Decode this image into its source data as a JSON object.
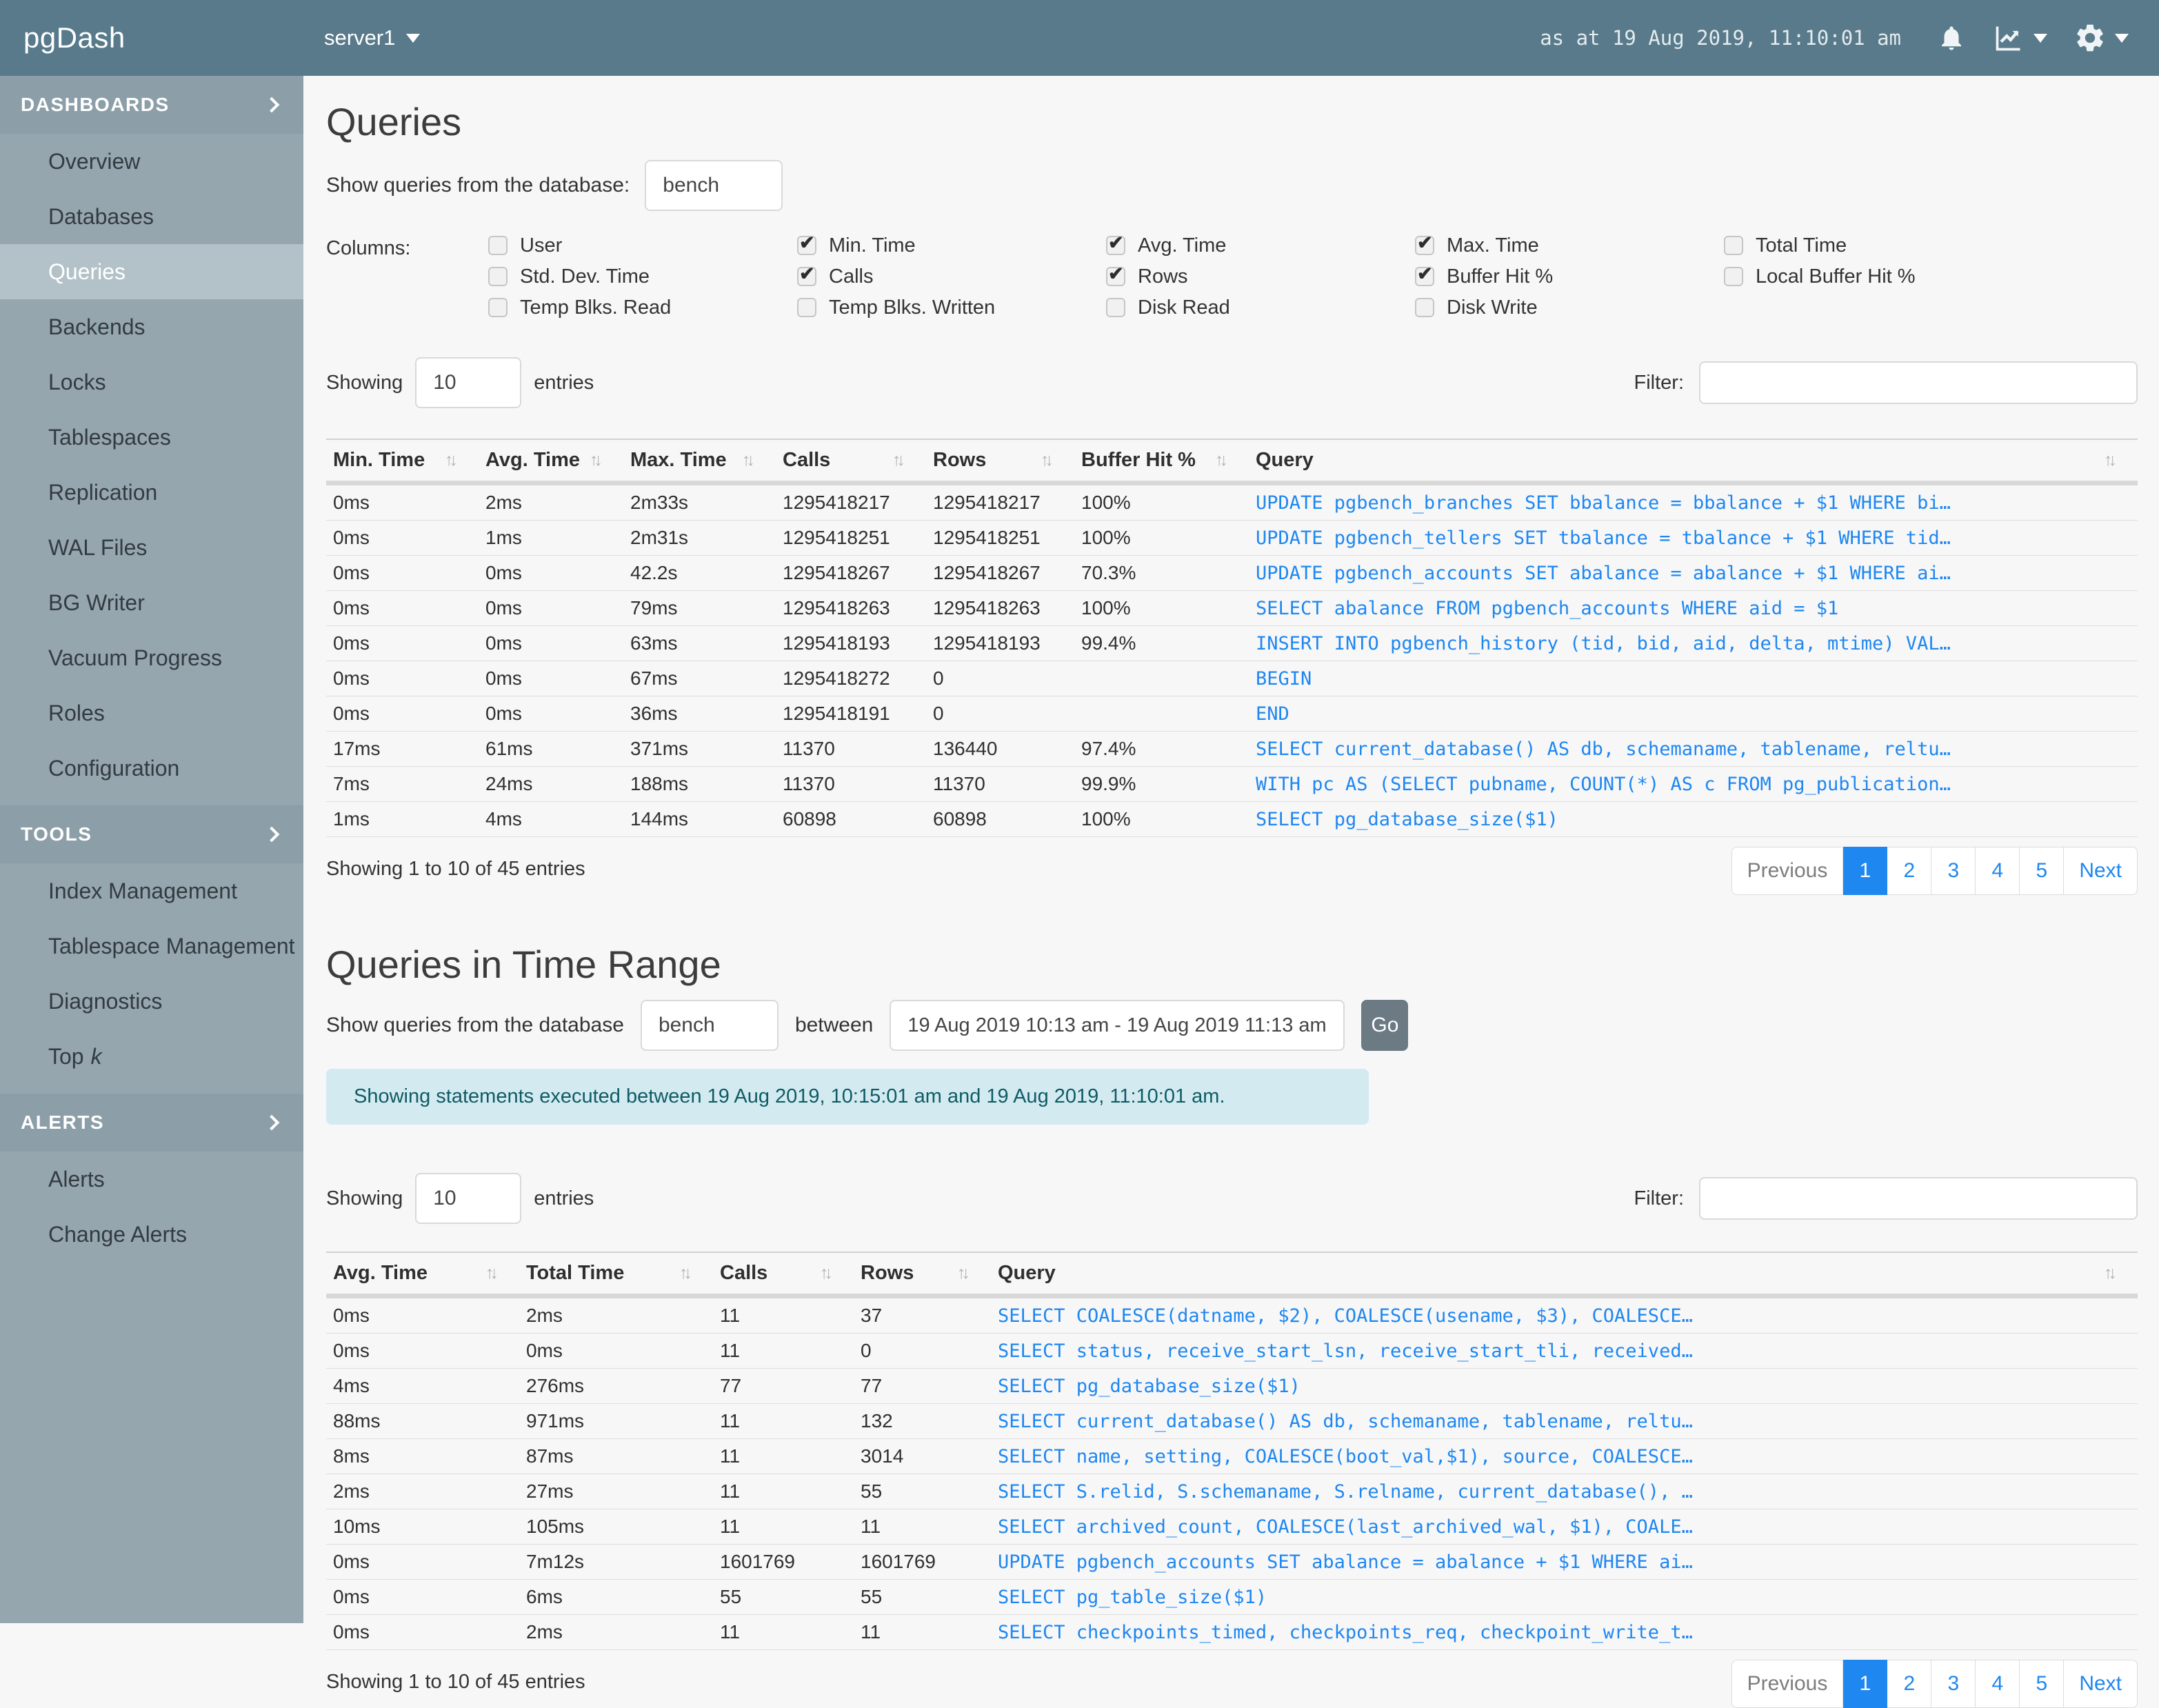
{
  "topbar": {
    "brand": "pgDash",
    "server": "server1",
    "timestamp": "as at 19 Aug 2019, 11:10:01 am"
  },
  "sidebar": {
    "sections": [
      {
        "label": "DASHBOARDS",
        "items": [
          {
            "label": "Overview"
          },
          {
            "label": "Databases"
          },
          {
            "label": "Queries",
            "active": true
          },
          {
            "label": "Backends"
          },
          {
            "label": "Locks"
          },
          {
            "label": "Tablespaces"
          },
          {
            "label": "Replication"
          },
          {
            "label": "WAL Files"
          },
          {
            "label": "BG Writer"
          },
          {
            "label": "Vacuum Progress"
          },
          {
            "label": "Roles"
          },
          {
            "label": "Configuration"
          }
        ]
      },
      {
        "label": "TOOLS",
        "items": [
          {
            "label": "Index Management"
          },
          {
            "label": "Tablespace Management"
          },
          {
            "label": "Diagnostics"
          },
          {
            "label": "Top",
            "italic": "k"
          }
        ]
      },
      {
        "label": "ALERTS",
        "items": [
          {
            "label": "Alerts"
          },
          {
            "label": "Change Alerts"
          }
        ]
      }
    ]
  },
  "q1": {
    "title": "Queries",
    "db_label": "Show queries from the database:",
    "db_value": "bench",
    "columns_label": "Columns:",
    "checkbox_columns": [
      [
        {
          "label": "User",
          "checked": false
        },
        {
          "label": "Std. Dev. Time",
          "checked": false
        },
        {
          "label": "Temp Blks. Read",
          "checked": false
        }
      ],
      [
        {
          "label": "Min. Time",
          "checked": true
        },
        {
          "label": "Calls",
          "checked": true
        },
        {
          "label": "Temp Blks. Written",
          "checked": false
        }
      ],
      [
        {
          "label": "Avg. Time",
          "checked": true
        },
        {
          "label": "Rows",
          "checked": true
        },
        {
          "label": "Disk Read",
          "checked": false
        }
      ],
      [
        {
          "label": "Max. Time",
          "checked": true
        },
        {
          "label": "Buffer Hit %",
          "checked": true
        },
        {
          "label": "Disk Write",
          "checked": false
        }
      ],
      [
        {
          "label": "Total Time",
          "checked": false
        },
        {
          "label": "Local Buffer Hit %",
          "checked": false
        }
      ]
    ],
    "showing_label": "Showing",
    "entries_value": "10",
    "entries_label": "entries",
    "filter_label": "Filter:",
    "filter_value": "",
    "table": {
      "headers": [
        "Min. Time",
        "Avg. Time",
        "Max. Time",
        "Calls",
        "Rows",
        "Buffer Hit %",
        "Query"
      ],
      "rows": [
        [
          "0ms",
          "2ms",
          "2m33s",
          "1295418217",
          "1295418217",
          "100%",
          "UPDATE pgbench_branches SET bbalance = bbalance + $1 WHERE bi…"
        ],
        [
          "0ms",
          "1ms",
          "2m31s",
          "1295418251",
          "1295418251",
          "100%",
          "UPDATE pgbench_tellers SET tbalance = tbalance + $1 WHERE tid…"
        ],
        [
          "0ms",
          "0ms",
          "42.2s",
          "1295418267",
          "1295418267",
          "70.3%",
          "UPDATE pgbench_accounts SET abalance = abalance + $1 WHERE ai…"
        ],
        [
          "0ms",
          "0ms",
          "79ms",
          "1295418263",
          "1295418263",
          "100%",
          "SELECT abalance FROM pgbench_accounts WHERE aid = $1"
        ],
        [
          "0ms",
          "0ms",
          "63ms",
          "1295418193",
          "1295418193",
          "99.4%",
          "INSERT INTO pgbench_history (tid, bid, aid, delta, mtime) VAL…"
        ],
        [
          "0ms",
          "0ms",
          "67ms",
          "1295418272",
          "0",
          "",
          "BEGIN"
        ],
        [
          "0ms",
          "0ms",
          "36ms",
          "1295418191",
          "0",
          "",
          "END"
        ],
        [
          "17ms",
          "61ms",
          "371ms",
          "11370",
          "136440",
          "97.4%",
          "SELECT current_database() AS db, schemaname, tablename, reltu…"
        ],
        [
          "7ms",
          "24ms",
          "188ms",
          "11370",
          "11370",
          "99.9%",
          "WITH pc AS (SELECT pubname, COUNT(*) AS c FROM pg_publication…"
        ],
        [
          "1ms",
          "4ms",
          "144ms",
          "60898",
          "60898",
          "100%",
          "SELECT pg_database_size($1)"
        ]
      ]
    },
    "summary": "Showing 1 to 10 of 45 entries",
    "pagination": {
      "previous": "Previous",
      "pages": [
        "1",
        "2",
        "3",
        "4",
        "5"
      ],
      "active": "1",
      "next": "Next"
    }
  },
  "q2": {
    "title": "Queries in Time Range",
    "db_label": "Show queries from the database",
    "db_value": "bench",
    "between_label": "between",
    "range_value": "19 Aug 2019 10:13 am - 19 Aug 2019 11:13 am",
    "go_label": "Go",
    "alert": "Showing statements executed between 19 Aug 2019, 10:15:01 am and 19 Aug 2019, 11:10:01 am.",
    "showing_label": "Showing",
    "entries_value": "10",
    "entries_label": "entries",
    "filter_label": "Filter:",
    "filter_value": "",
    "table": {
      "headers": [
        "Avg. Time",
        "Total Time",
        "Calls",
        "Rows",
        "Query"
      ],
      "rows": [
        [
          "0ms",
          "2ms",
          "11",
          "37",
          "SELECT COALESCE(datname, $2), COALESCE(usename, $3), COALESCE…"
        ],
        [
          "0ms",
          "0ms",
          "11",
          "0",
          "SELECT status, receive_start_lsn, receive_start_tli, received…"
        ],
        [
          "4ms",
          "276ms",
          "77",
          "77",
          "SELECT pg_database_size($1)"
        ],
        [
          "88ms",
          "971ms",
          "11",
          "132",
          "SELECT current_database() AS db, schemaname, tablename, reltu…"
        ],
        [
          "8ms",
          "87ms",
          "11",
          "3014",
          "SELECT name, setting, COALESCE(boot_val,$1), source, COALESCE…"
        ],
        [
          "2ms",
          "27ms",
          "11",
          "55",
          "SELECT S.relid, S.schemaname, S.relname, current_database(), …"
        ],
        [
          "10ms",
          "105ms",
          "11",
          "11",
          "SELECT archived_count, COALESCE(last_archived_wal, $1), COALE…"
        ],
        [
          "0ms",
          "7m12s",
          "1601769",
          "1601769",
          "UPDATE pgbench_accounts SET abalance = abalance + $1 WHERE ai…"
        ],
        [
          "0ms",
          "6ms",
          "55",
          "55",
          "SELECT pg_table_size($1)"
        ],
        [
          "0ms",
          "2ms",
          "11",
          "11",
          "SELECT checkpoints_timed, checkpoints_req, checkpoint_write_t…"
        ]
      ]
    },
    "summary": "Showing 1 to 10 of 45 entries",
    "pagination": {
      "previous": "Previous",
      "pages": [
        "1",
        "2",
        "3",
        "4",
        "5"
      ],
      "active": "1",
      "next": "Next"
    }
  }
}
